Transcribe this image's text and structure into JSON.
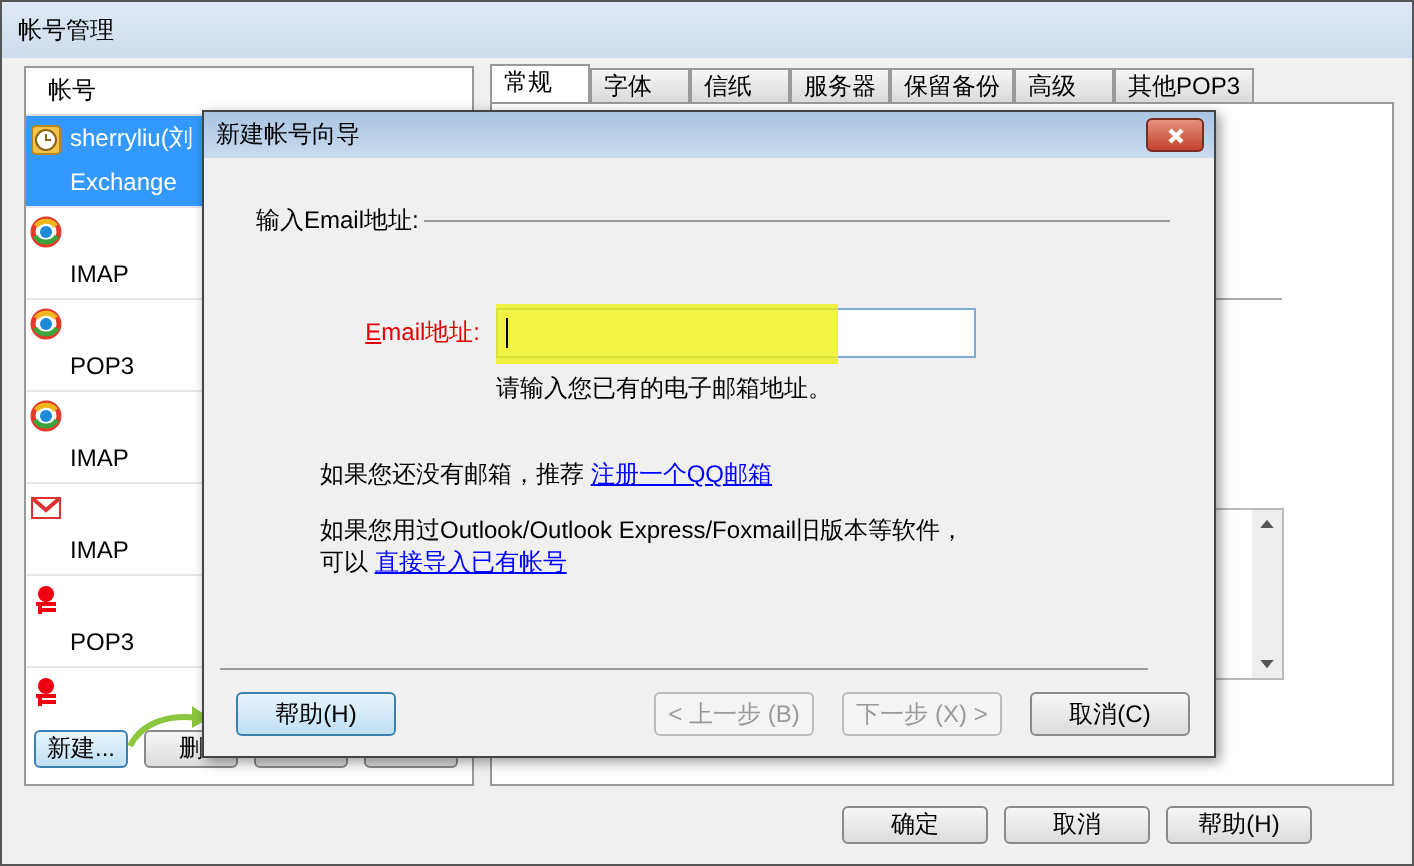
{
  "window": {
    "title": "帐号管理"
  },
  "account_list": {
    "header": "帐号",
    "items": [
      {
        "kind": "exchange",
        "name": "sherryliu(刘",
        "protocol": "Exchange",
        "selected": true
      },
      {
        "kind": "qq",
        "protocol": "IMAP",
        "selected": false
      },
      {
        "kind": "qq",
        "protocol": "POP3",
        "selected": false
      },
      {
        "kind": "qq",
        "protocol": "IMAP",
        "selected": false
      },
      {
        "kind": "gmail",
        "protocol": "IMAP",
        "selected": false
      },
      {
        "kind": "netease",
        "protocol": "POP3",
        "selected": false
      },
      {
        "kind": "netease",
        "selected": false
      }
    ],
    "buttons": [
      {
        "kind": "text",
        "label": "新建..."
      },
      {
        "kind": "text",
        "label": "删"
      },
      {
        "kind": "blank"
      },
      {
        "kind": "blank"
      }
    ]
  },
  "tabs": [
    {
      "label": "常规",
      "selected": true
    },
    {
      "label": "字体",
      "selected": false
    },
    {
      "label": "信纸",
      "selected": false
    },
    {
      "label": "服务器",
      "selected": false
    },
    {
      "label": "保留备份",
      "selected": false
    },
    {
      "label": "高级",
      "selected": false
    },
    {
      "label": "其他POP3",
      "selected": false
    }
  ],
  "buttons": [
    {
      "label": "确定"
    },
    {
      "label": "取消"
    },
    {
      "label": "帮助(H)"
    }
  ],
  "dialog": {
    "title": "新建帐号向导",
    "section": "输入Email地址:",
    "email_label": "**E**mail地址:",
    "hint": "请输入您已有的电子邮箱地址。",
    "paragraphs": [
      {
        "lines": [
          {
            "text": "如果您还没有邮箱，推荐 ",
            "link": "注册一个QQ邮箱"
          }
        ]
      },
      {
        "lines": [
          {
            "text": "如果您用过Outlook/Outlook Express/Foxmail旧版本等软件，"
          },
          {
            "text": "可以 ",
            "link": "直接导入已有帐号"
          }
        ]
      }
    ],
    "buttons": [
      {
        "label": "帮助(H)",
        "disabled": false,
        "focused": true
      },
      {
        "label": "< 上一步 (B)",
        "disabled": true,
        "focused": false
      },
      {
        "label": "下一步 (X) >",
        "disabled": true,
        "focused": false
      },
      {
        "label": "取消(C)",
        "disabled": false,
        "focused": false
      }
    ]
  }
}
